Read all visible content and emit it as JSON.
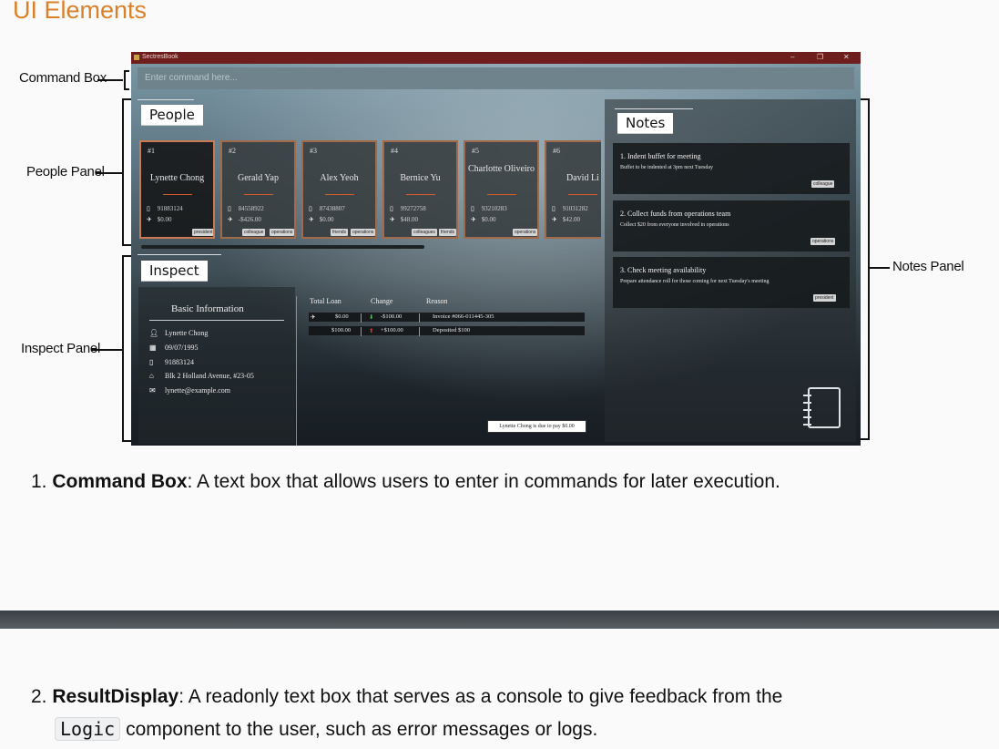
{
  "page": {
    "heading": "UI Elements"
  },
  "callouts": {
    "command_box": "Command Box",
    "people_panel": "People Panel",
    "inspect_panel": "Inspect Panel",
    "notes_panel": "Notes Panel"
  },
  "window": {
    "title": "SectresBook",
    "minimize": "–",
    "restore": "❐",
    "close": "✕"
  },
  "command": {
    "placeholder": "Enter command here..."
  },
  "panels": {
    "people": "People",
    "inspect": "Inspect",
    "notes": "Notes"
  },
  "people": [
    {
      "index": "#1",
      "name": "Lynette Chong",
      "phone": "91883124",
      "loan": "$0.00",
      "tags": [
        "president"
      ],
      "selected": true
    },
    {
      "index": "#2",
      "name": "Gerald Yap",
      "phone": "84558922",
      "loan": "-$426.00",
      "tags": [
        "colleague",
        "operations"
      ]
    },
    {
      "index": "#3",
      "name": "Alex Yeoh",
      "phone": "87438807",
      "loan": "$0.00",
      "tags": [
        "friends",
        "operations"
      ]
    },
    {
      "index": "#4",
      "name": "Bernice Yu",
      "phone": "99272758",
      "loan": "$48.00",
      "tags": [
        "colleagues",
        "friends"
      ]
    },
    {
      "index": "#5",
      "name": "Charlotte Oliveiro",
      "phone": "93210283",
      "loan": "$0.00",
      "tags": [
        "operations"
      ]
    },
    {
      "index": "#6",
      "name": "David Li",
      "phone": "91031282",
      "loan": "$42.00",
      "tags": []
    }
  ],
  "inspect": {
    "title": "Basic Information",
    "name": "Lynette Chong",
    "birthday": "09/07/1995",
    "phone": "91883124",
    "address": "Blk 2 Holland Avenue, #23-05",
    "email": "lynette@example.com",
    "loan_headers": {
      "total": "Total Loan",
      "change": "Change",
      "reason": "Reason"
    },
    "loan_rows": [
      {
        "total": "$0.00",
        "change": "-$100.00",
        "reason": "Invoice #066-011445-305",
        "direction": "down"
      },
      {
        "total": "$100.00",
        "change": "+$100.00",
        "reason": "Deposited $100",
        "direction": "up"
      }
    ],
    "due_message": "Lynette Chong is due to pay $0.00"
  },
  "notes": [
    {
      "title": "1.  Indent buffet for meeting",
      "desc": "Buffet to be indented at 3pm next Tuesday",
      "tag": "colleague"
    },
    {
      "title": "2.  Collect funds from operations team",
      "desc": "Collect $20 from everyone involved in operations",
      "tag": "operations"
    },
    {
      "title": "3.  Check meeting availability",
      "desc": "Prepare attendance roll for those coming for next Tuesday's meeting",
      "tag": "president"
    }
  ],
  "descriptions": [
    {
      "number": "1.",
      "term": "Command Box",
      "text": ": A text box that allows users to enter in commands for later execution."
    },
    {
      "number": "2.",
      "term": "ResultDisplay",
      "text": ": A readonly text box that serves as a console to give feedback from the",
      "code": "Logic",
      "text2": "component to the user, such as error messages or logs."
    }
  ],
  "colors": {
    "accent": "#d9812a",
    "titlebar": "#6e1e1c",
    "card_border": "#a16a4b"
  }
}
